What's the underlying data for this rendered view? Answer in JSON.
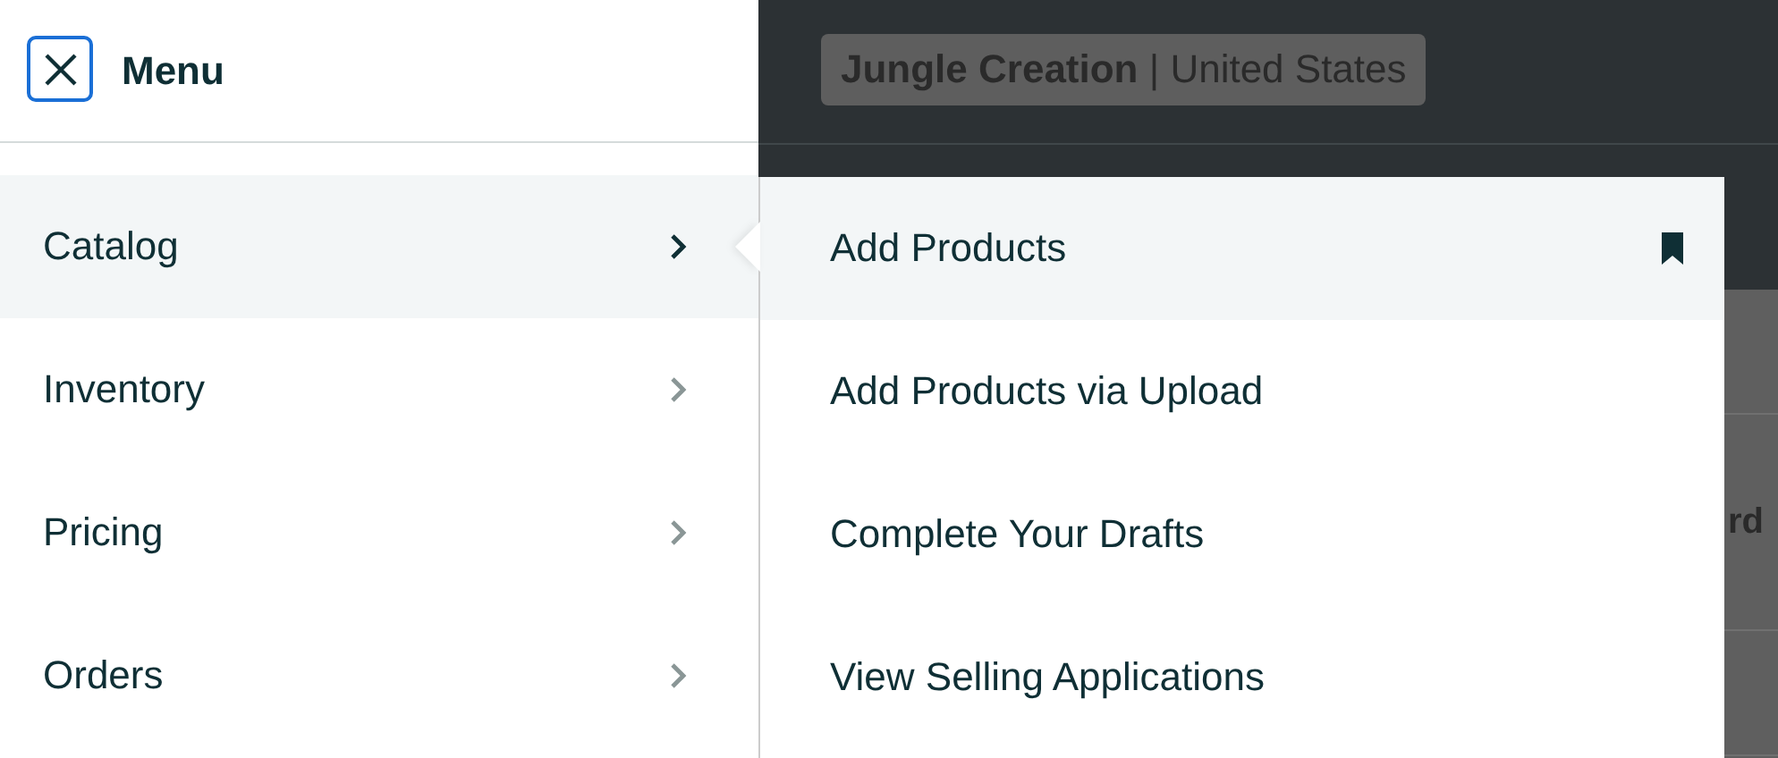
{
  "menu": {
    "title": "Menu",
    "items": [
      {
        "label": "Catalog",
        "selected": true
      },
      {
        "label": "Inventory",
        "selected": false
      },
      {
        "label": "Pricing",
        "selected": false
      },
      {
        "label": "Orders",
        "selected": false
      }
    ]
  },
  "store_badge": "**Jungle Creation** | United States",
  "submenu": [
    {
      "label": "Add Products",
      "selected": true,
      "bookmarked": true
    },
    {
      "label": "Add Products via Upload",
      "selected": false,
      "bookmarked": false
    },
    {
      "label": "Complete Your Drafts",
      "selected": false,
      "bookmarked": false
    },
    {
      "label": "View Selling Applications",
      "selected": false,
      "bookmarked": false
    }
  ],
  "background_text": "rd"
}
